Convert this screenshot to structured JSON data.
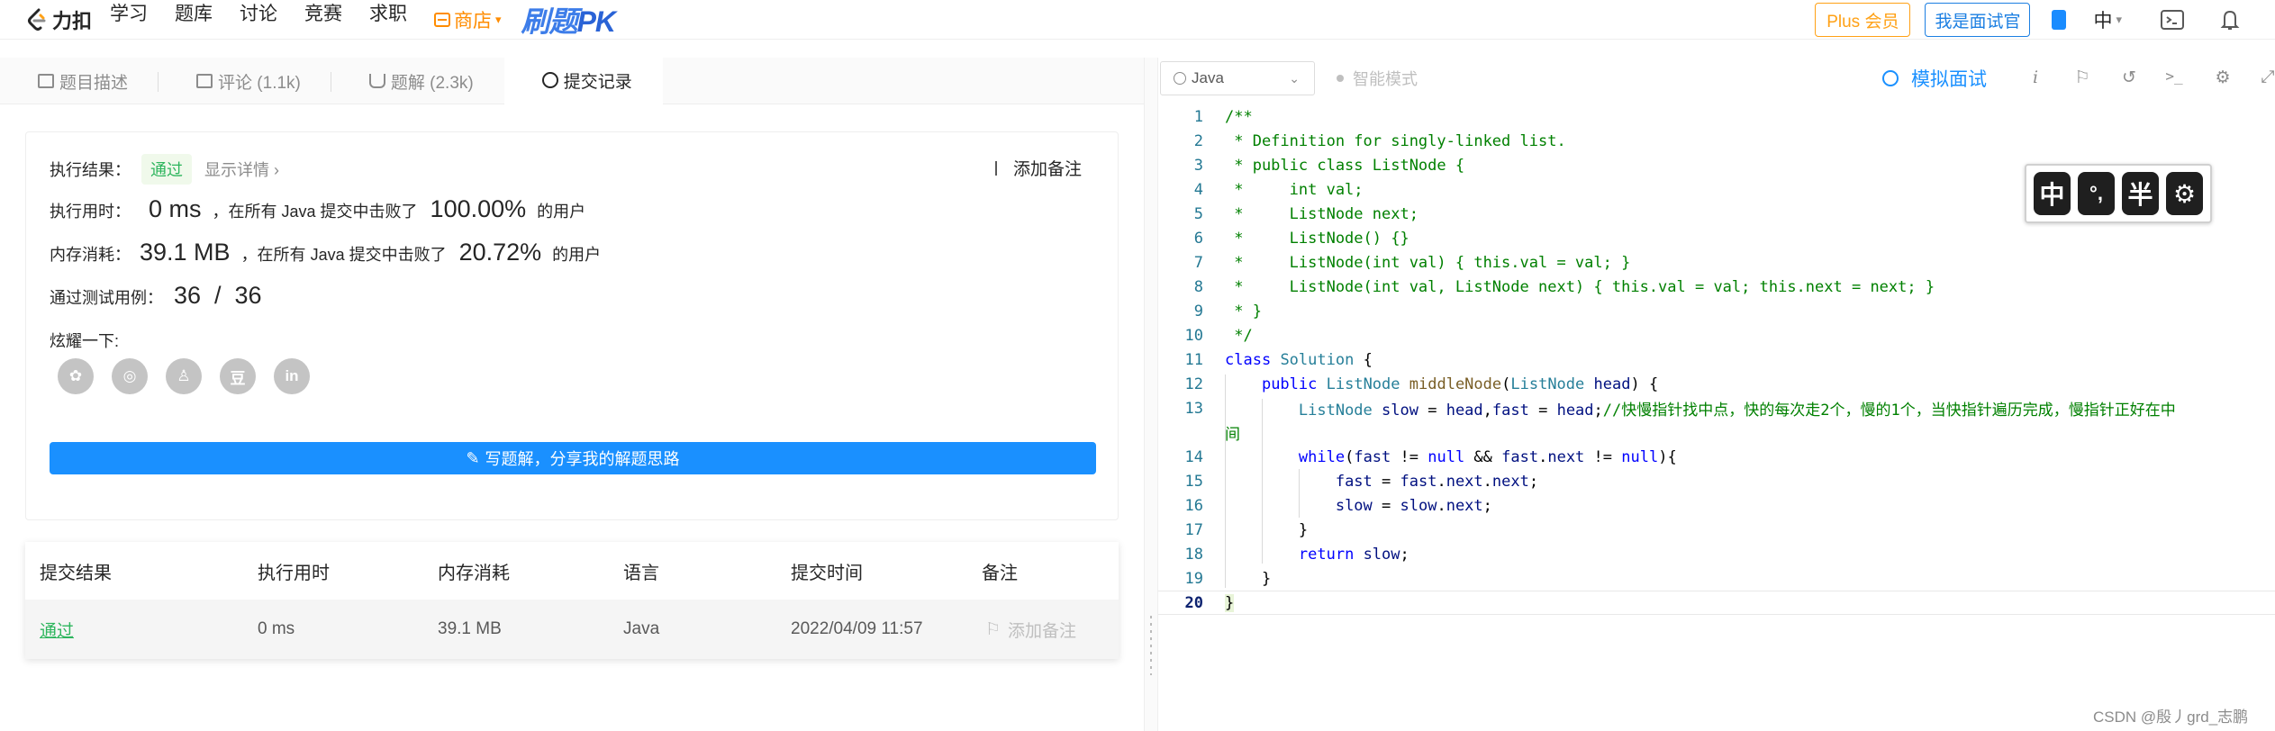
{
  "topnav": {
    "logo_text": "力扣",
    "items": [
      "学习",
      "题库",
      "讨论",
      "竞赛",
      "求职"
    ],
    "shop_label": "商店",
    "pk_label_a": "刷题",
    "pk_label_b": "PK",
    "plus_label": "Plus 会员",
    "interview_label": "我是面试官",
    "lang_label": "中"
  },
  "left_tabs": [
    {
      "label": "题目描述"
    },
    {
      "label": "评论 (1.1k)"
    },
    {
      "label": "题解 (2.3k)"
    },
    {
      "label": "提交记录"
    }
  ],
  "result": {
    "status_label": "执行结果：",
    "status_value": "通过",
    "detail_link": "显示详情 ›",
    "add_note": "添加备注",
    "runtime_label": "执行用时：",
    "runtime_value": "0 ms",
    "runtime_mid": "，在所有 Java 提交中击败了",
    "runtime_pct": "100.00%",
    "runtime_suffix": "的用户",
    "memory_label": "内存消耗：",
    "memory_value": "39.1 MB",
    "memory_mid": "，在所有 Java 提交中击败了",
    "memory_pct": "20.72%",
    "memory_suffix": "的用户",
    "tests_label": "通过测试用例：",
    "tests_value": "36  /  36",
    "share_label": "炫耀一下:",
    "share_icons": [
      "wechat-icon",
      "weibo-icon",
      "qq-icon",
      "douban-icon",
      "linkedin-icon"
    ],
    "share_glyphs": [
      "✿",
      "◎",
      "♙",
      "豆",
      "in"
    ],
    "write_button": "写题解，分享我的解题思路"
  },
  "submissions": {
    "headers": [
      "提交结果",
      "执行用时",
      "内存消耗",
      "语言",
      "提交时间",
      "备注"
    ],
    "rows": [
      {
        "status": "通过",
        "runtime": "0 ms",
        "memory": "39.1 MB",
        "language": "Java",
        "time": "2022/04/09 11:57",
        "note": "添加备注"
      }
    ]
  },
  "editor": {
    "language": "Java",
    "smart_mode": "智能模式",
    "mock_interview": "模拟面试",
    "current_line": 20
  },
  "ime": {
    "keys": [
      "中",
      "°,",
      "半",
      "⚙"
    ]
  },
  "watermark": "CSDN @殷丿grd_志鹏",
  "colors": {
    "accent": "#1a90ff",
    "pass": "#2db55d",
    "plus": "#ffa116"
  }
}
